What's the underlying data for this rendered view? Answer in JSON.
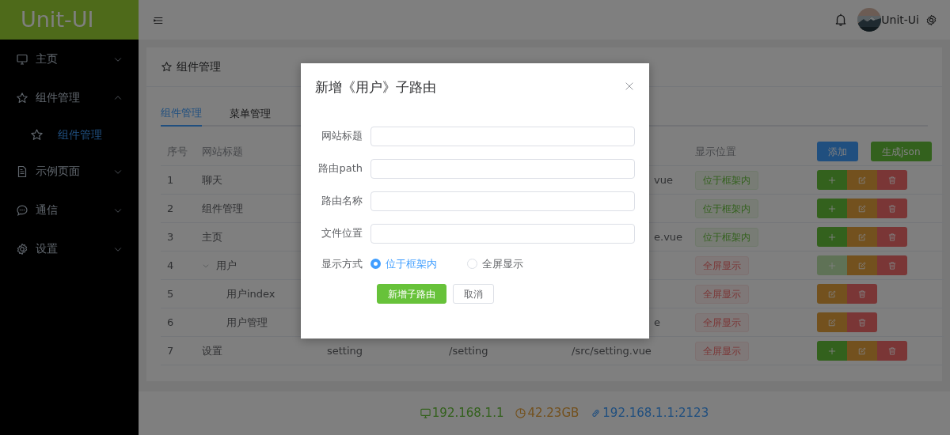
{
  "app": {
    "logo": "Unit-UI"
  },
  "sidebar": {
    "items": [
      {
        "label": "主页",
        "kind": "monitor",
        "expanded": false,
        "selected": false
      },
      {
        "label": "组件管理",
        "kind": "star",
        "expanded": true,
        "selected": false,
        "children": [
          {
            "label": "组件管理",
            "kind": "star",
            "selected": true
          }
        ]
      },
      {
        "label": "示例页面",
        "kind": "document",
        "expanded": false,
        "selected": false
      },
      {
        "label": "通信",
        "kind": "chat",
        "expanded": false,
        "selected": false
      },
      {
        "label": "设置",
        "kind": "gear",
        "expanded": false,
        "selected": false
      }
    ]
  },
  "header": {
    "user": "Unit-Ui"
  },
  "panel": {
    "title": "组件管理",
    "tabs": [
      {
        "label": "组件管理",
        "selected": true
      },
      {
        "label": "菜单管理",
        "selected": false
      }
    ],
    "table": {
      "columns": {
        "index": "序号",
        "title": "网站标题",
        "display": "显示位置"
      },
      "toolbar": [
        {
          "label": "添加",
          "kind": "blue"
        },
        {
          "label": "生成json",
          "kind": "green"
        }
      ],
      "rows": [
        {
          "index": "1",
          "title": "聊天",
          "column_5": "vue",
          "column_5_cut": true,
          "display": {
            "text": "位于框架内",
            "kind": "inframe"
          },
          "actions": [
            {
              "kind": "add",
              "disabled": false
            },
            {
              "kind": "edit",
              "disabled": false
            },
            {
              "kind": "delete",
              "disabled": false
            }
          ]
        },
        {
          "index": "2",
          "title": "组件管理",
          "display": {
            "text": "位于框架内",
            "kind": "inframe"
          },
          "actions": [
            {
              "kind": "add",
              "disabled": false
            },
            {
              "kind": "edit",
              "disabled": false
            },
            {
              "kind": "delete",
              "disabled": false
            }
          ]
        },
        {
          "index": "3",
          "title": "主页",
          "column_5": "e.vue",
          "column_5_cut": true,
          "display": {
            "text": "位于框架内",
            "kind": "inframe"
          },
          "actions": [
            {
              "kind": "add",
              "disabled": false
            },
            {
              "kind": "edit",
              "disabled": false
            },
            {
              "kind": "delete",
              "disabled": false
            }
          ]
        },
        {
          "index": "4",
          "title": "用户",
          "expanded": true,
          "display": {
            "text": "全屏显示",
            "kind": "fullscreen"
          },
          "actions": [
            {
              "kind": "add",
              "disabled": true
            },
            {
              "kind": "edit",
              "disabled": false
            },
            {
              "kind": "delete",
              "disabled": false
            }
          ],
          "children": [
            {
              "index": "5",
              "title": "用户index",
              "display": {
                "text": "全屏显示",
                "kind": "fullscreen"
              },
              "actions": [
                {
                  "kind": "edit",
                  "disabled": false
                },
                {
                  "kind": "delete",
                  "disabled": false
                }
              ]
            },
            {
              "index": "6",
              "title": "用户管理",
              "column_5": "e",
              "column_5_cut": true,
              "display": {
                "text": "全屏显示",
                "kind": "fullscreen"
              },
              "actions": [
                {
                  "kind": "edit",
                  "disabled": false
                },
                {
                  "kind": "delete",
                  "disabled": false
                }
              ]
            }
          ]
        },
        {
          "index": "7",
          "title": "设置",
          "column_3": "setting",
          "column_4": "/setting",
          "column_5": "/src/setting.vue",
          "display": {
            "text": "全屏显示",
            "kind": "fullscreen"
          },
          "actions": [
            {
              "kind": "add",
              "disabled": false
            },
            {
              "kind": "edit",
              "disabled": false
            },
            {
              "kind": "delete",
              "disabled": false
            }
          ]
        }
      ]
    }
  },
  "footer": [
    {
      "text": "192.168.1.1",
      "kind": "monitor"
    },
    {
      "text": "42.23GB",
      "kind": "clock"
    },
    {
      "text": "192.168.1.1:2123",
      "kind": "link"
    }
  ],
  "dialog": {
    "title": "新增《用户》子路由",
    "fields": [
      {
        "label": "网站标题"
      },
      {
        "label": "路由path"
      },
      {
        "label": "路由名称"
      },
      {
        "label": "文件位置"
      }
    ],
    "radio": {
      "label": "显示方式",
      "options": [
        {
          "label": "位于框架内",
          "selected": true
        },
        {
          "label": "全屏显示",
          "selected": false
        }
      ]
    },
    "buttons": [
      {
        "label": "新增子路由",
        "kind": "primary"
      },
      {
        "label": "取消",
        "kind": "plain"
      }
    ]
  }
}
